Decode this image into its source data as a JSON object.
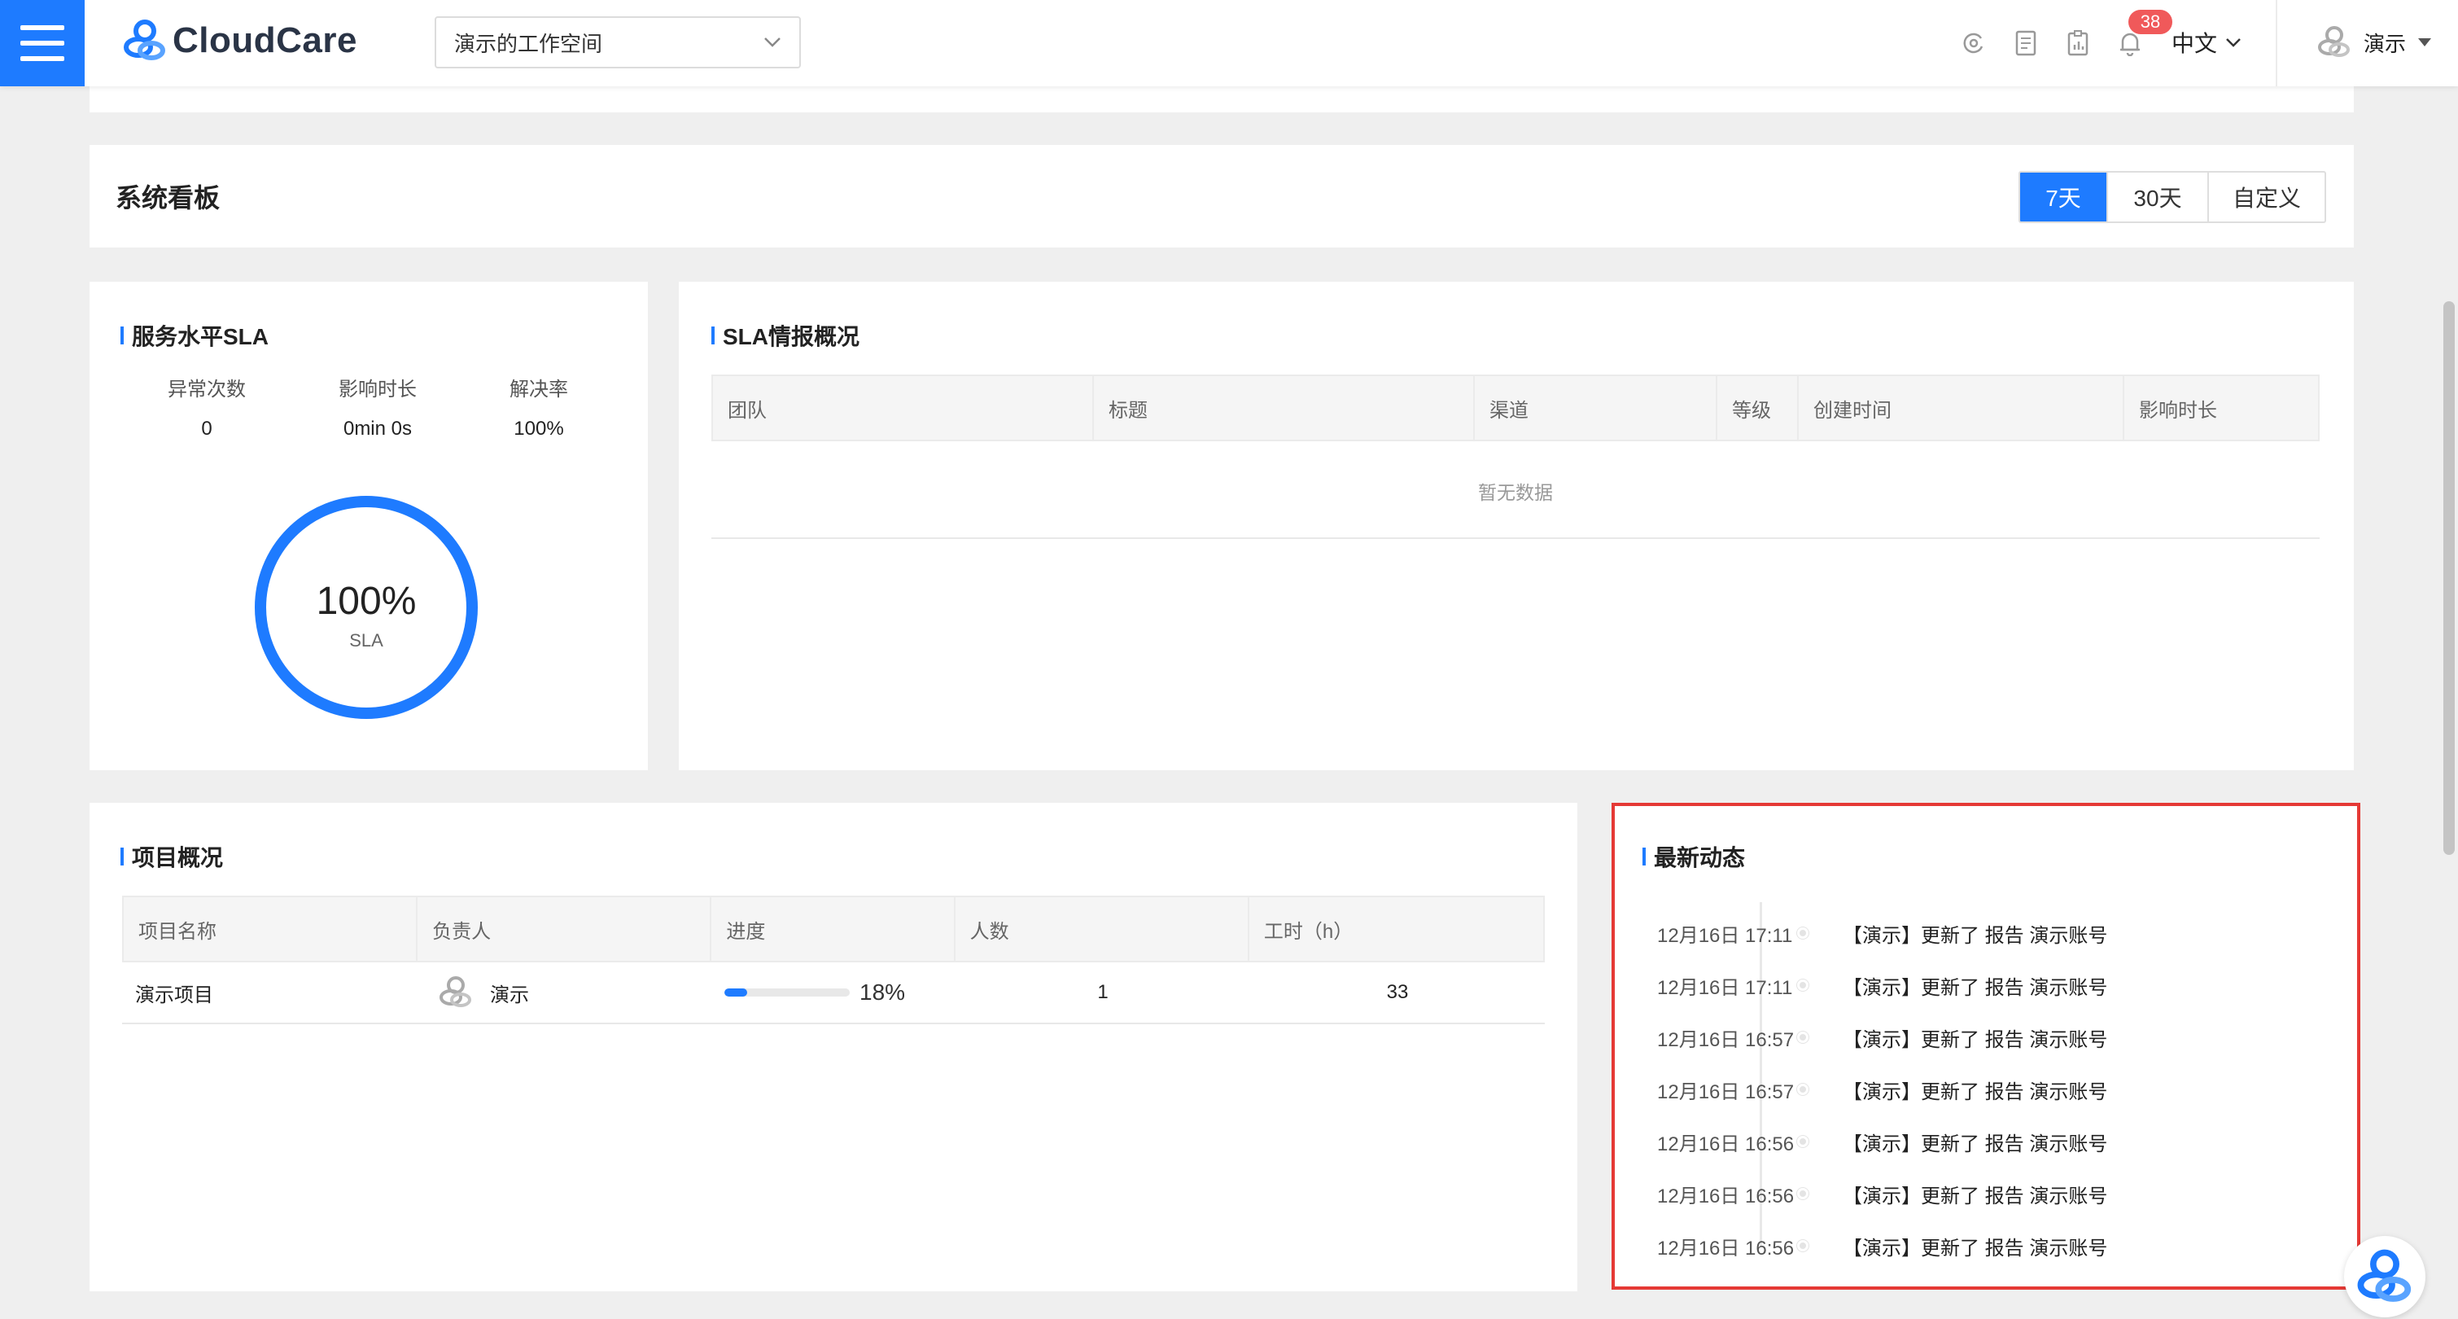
{
  "header": {
    "logo_text": "CloudCare",
    "workspace": "演示的工作空间",
    "notification_count": "38",
    "language": "中文",
    "user_name": "演示",
    "icons": [
      "menu-icon",
      "chevron-down-icon",
      "refresh-icon",
      "document-icon",
      "report-icon",
      "bell-icon",
      "user-avatar-icon",
      "caret-down-icon"
    ]
  },
  "board": {
    "title": "系统看板",
    "ranges": [
      "7天",
      "30天",
      "自定义"
    ],
    "active_range": "7天"
  },
  "sla": {
    "title": "服务水平SLA",
    "stats": [
      {
        "label": "异常次数",
        "value": "0"
      },
      {
        "label": "影响时长",
        "value": "0min 0s"
      },
      {
        "label": "解决率",
        "value": "100%"
      }
    ],
    "ring_value": "100%",
    "ring_label": "SLA",
    "ring_fraction": 1.0,
    "accent": "#1e7bff"
  },
  "intel": {
    "title": "SLA情报概况",
    "columns": [
      "团队",
      "标题",
      "渠道",
      "等级",
      "创建时间",
      "影响时长"
    ],
    "empty_text": "暂无数据"
  },
  "projects": {
    "title": "项目概况",
    "columns": [
      "项目名称",
      "负责人",
      "进度",
      "人数",
      "工时（h）"
    ],
    "rows": [
      {
        "name": "演示项目",
        "owner": "演示",
        "progress": "18%",
        "progress_fraction": 0.18,
        "members": "1",
        "hours": "33"
      }
    ]
  },
  "news": {
    "title": "最新动态",
    "items": [
      {
        "time": "12月16日 17:11",
        "text": "【演示】更新了 报告 演示账号"
      },
      {
        "time": "12月16日 17:11",
        "text": "【演示】更新了 报告 演示账号"
      },
      {
        "time": "12月16日 16:57",
        "text": "【演示】更新了 报告 演示账号"
      },
      {
        "time": "12月16日 16:57",
        "text": "【演示】更新了 报告 演示账号"
      },
      {
        "time": "12月16日 16:56",
        "text": "【演示】更新了 报告 演示账号"
      },
      {
        "time": "12月16日 16:56",
        "text": "【演示】更新了 报告 演示账号"
      },
      {
        "time": "12月16日 16:56",
        "text": "【演示】更新了 报告 演示账号"
      }
    ],
    "highlight_color": "#e53935"
  }
}
